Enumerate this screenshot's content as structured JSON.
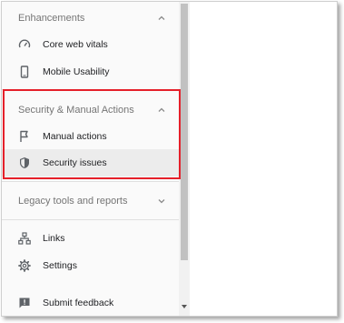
{
  "sidebar": {
    "sections": [
      {
        "title": "Enhancements",
        "expanded": true
      },
      {
        "title": "Security & Manual Actions",
        "expanded": true
      },
      {
        "title": "Legacy tools and reports",
        "expanded": false
      }
    ],
    "enhancements_items": [
      {
        "label": "Core web vitals",
        "icon": "speedometer-icon"
      },
      {
        "label": "Mobile Usability",
        "icon": "smartphone-icon"
      }
    ],
    "security_items": [
      {
        "label": "Manual actions",
        "icon": "flag-icon"
      },
      {
        "label": "Security issues",
        "icon": "shield-icon",
        "active": true
      }
    ],
    "bottom_items": [
      {
        "label": "Links",
        "icon": "sitemap-icon"
      },
      {
        "label": "Settings",
        "icon": "gear-icon"
      },
      {
        "label": "Submit feedback",
        "icon": "feedback-icon"
      }
    ]
  },
  "colors": {
    "highlight": "#e5202a",
    "active_bg": "#ececec",
    "sidebar_bg": "#fafafa"
  }
}
